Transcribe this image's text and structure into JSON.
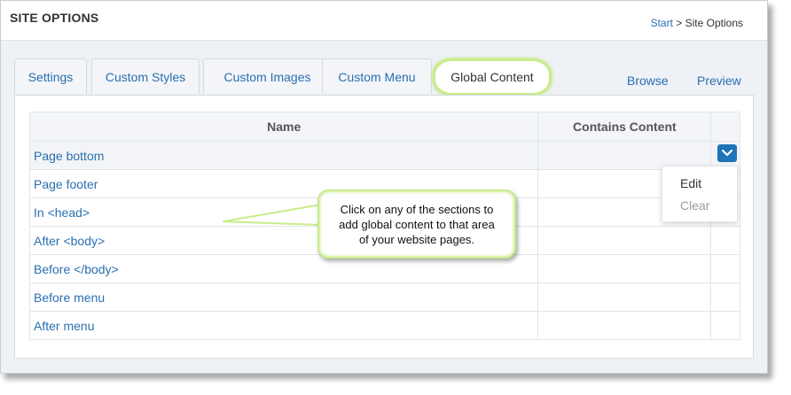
{
  "header": {
    "title": "SITE OPTIONS",
    "breadcrumb": {
      "start": "Start",
      "separator": ">",
      "current": "Site Options"
    }
  },
  "tabs": [
    {
      "label": "Settings"
    },
    {
      "label": "Custom Styles"
    },
    {
      "label": "Custom Images"
    },
    {
      "label": "Custom Menu"
    },
    {
      "label": "Global Content",
      "active": true
    }
  ],
  "actions": {
    "browse": "Browse",
    "preview": "Preview"
  },
  "table": {
    "headers": {
      "name": "Name",
      "contains_content": "Contains Content"
    },
    "rows": [
      {
        "name": "Page bottom"
      },
      {
        "name": "Page footer"
      },
      {
        "name": "In <head>"
      },
      {
        "name": "After <body>"
      },
      {
        "name": "Before </body>"
      },
      {
        "name": "Before menu"
      },
      {
        "name": "After menu"
      }
    ]
  },
  "dropdown": {
    "edit": "Edit",
    "clear": "Clear"
  },
  "callout": {
    "line1": "Click on any of the sections to",
    "line2": "add global content to that area",
    "line3": "of your website pages."
  },
  "colors": {
    "link": "#2a6fb0",
    "highlight": "#c8ec8a",
    "button": "#1f74b8",
    "disabled": "#999999"
  },
  "icons": {
    "dropdown_button": "chevron-down-icon"
  }
}
